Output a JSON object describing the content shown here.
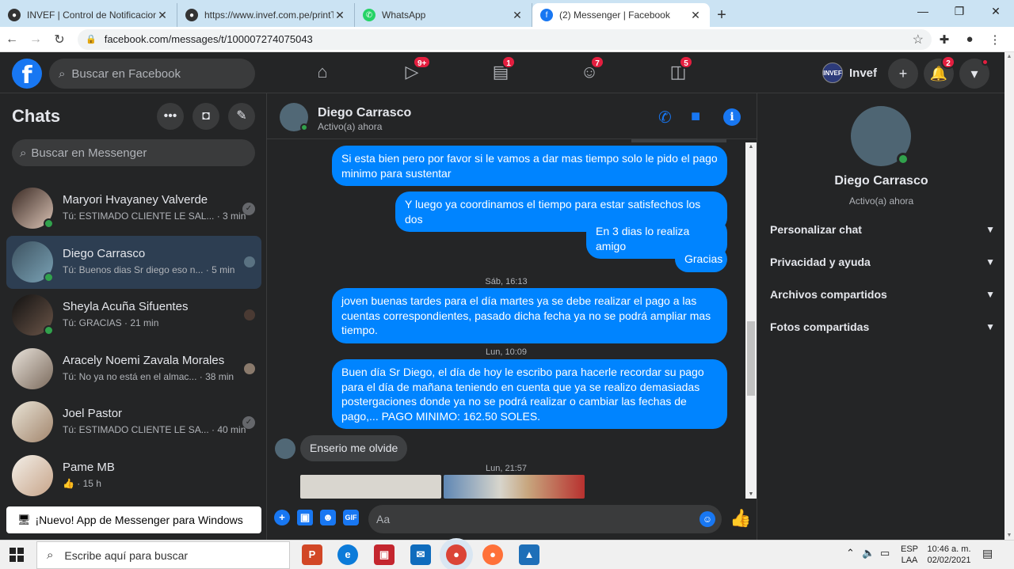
{
  "browser": {
    "tabs": [
      {
        "title": "INVEF | Control de Notificaciones"
      },
      {
        "title": "https://www.invef.com.pe/printTi"
      },
      {
        "title": "WhatsApp"
      },
      {
        "title": "(2) Messenger | Facebook"
      }
    ],
    "url": "facebook.com/messages/t/100007274075043"
  },
  "fb": {
    "search_placeholder": "Buscar en Facebook",
    "badges": {
      "watch": "9+",
      "marketplace": "1",
      "groups": "7",
      "gaming": "5",
      "notifications": "2"
    },
    "profile_name": "Invef",
    "profile_logo_text": "INVEF"
  },
  "sidebar": {
    "title": "Chats",
    "search_placeholder": "Buscar en Messenger",
    "chats": [
      {
        "name": "Maryori Hvayaney Valverde",
        "preview": "Tú: ESTIMADO CLIENTE LE SAL... · 3 min"
      },
      {
        "name": "Diego Carrasco",
        "preview": "Tú: Buenos dias Sr diego eso n... · 5 min"
      },
      {
        "name": "Sheyla Acuña Sifuentes",
        "preview": "Tú: GRACIAS · 21 min"
      },
      {
        "name": "Aracely Noemi Zavala Morales",
        "preview": "Tú: No ya no está en el almac... · 38 min"
      },
      {
        "name": "Joel Pastor",
        "preview": "Tú: ESTIMADO CLIENTE LE SA... · 40 min"
      },
      {
        "name": "Pame MB",
        "preview": "· 15 h"
      }
    ],
    "promo": "¡Nuevo! App de Messenger para Windows"
  },
  "conversation": {
    "name": "Diego Carrasco",
    "status": "Activo(a) ahora",
    "messages": [
      {
        "text": "Si esta bien pero por favor  si le vamos a dar mas tiempo solo le pido el pago minimo para sustentar"
      },
      {
        "text": "Y luego ya coordinamos el tiempo para estar satisfechos los dos"
      },
      {
        "text": "En 3 dias lo realiza amigo"
      },
      {
        "text": "Gracias"
      },
      {
        "text": "joven buenas tardes para el día martes ya se debe realizar el pago a las cuentas correspondientes, pasado dicha fecha ya no se podrá ampliar mas tiempo."
      },
      {
        "text": "Buen día Sr Diego, el día de hoy le escribo para hacerle recordar su pago para el día de mañana  teniendo en cuenta que ya se realizo demasiadas postergaciones donde ya no se podrá realizar o cambiar las fechas de pago,... PAGO MINIMO: 162.50 SOLES."
      },
      {
        "text": "Enserio me olvide"
      }
    ],
    "timestamps": [
      "Sáb, 16:13",
      "Lun, 10:09",
      "Lun, 21:57"
    ],
    "composer_placeholder": "Aa"
  },
  "details": {
    "name": "Diego Carrasco",
    "status": "Activo(a) ahora",
    "sections": [
      "Personalizar chat",
      "Privacidad y ayuda",
      "Archivos compartidos",
      "Fotos compartidas"
    ]
  },
  "taskbar": {
    "search_placeholder": "Escribe aquí para buscar",
    "lang_top": "ESP",
    "lang_bottom": "LAA",
    "time": "10:46 a. m.",
    "date": "02/02/2021"
  },
  "icons": [
    "home-icon",
    "watch-icon",
    "marketplace-icon",
    "groups-icon",
    "gaming-icon",
    "phone-icon",
    "video-icon",
    "info-icon",
    "like-icon",
    "chevron-down-icon"
  ],
  "colors": {
    "accent": "#1877f2",
    "bubble_out": "#0084ff",
    "bubble_in": "#3e4042",
    "online": "#31a24c",
    "badge": "#e41e3f"
  }
}
